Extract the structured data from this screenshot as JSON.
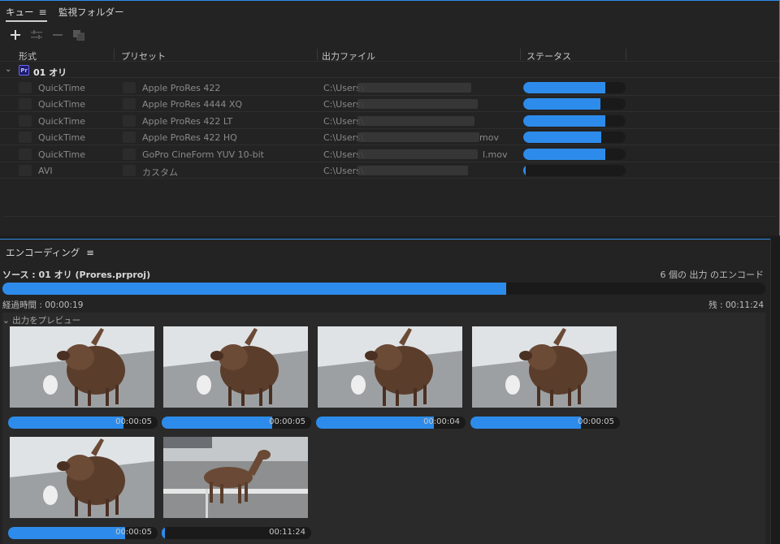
{
  "queue": {
    "tabs": [
      {
        "label": "キュー",
        "active": true
      },
      {
        "label": "監視フォルダー",
        "active": false
      }
    ],
    "menu_icon": "≡",
    "columns": {
      "format": "形式",
      "preset": "プリセット",
      "output": "出力ファイル",
      "status": "ステータス"
    },
    "group": {
      "badge": "Pr",
      "title": "01 オリ"
    },
    "rows": [
      {
        "format": "QuickTime",
        "preset": "Apple ProRes 422",
        "path": "C:\\Users\\",
        "suffix": "",
        "progress": 0.8
      },
      {
        "format": "QuickTime",
        "preset": "Apple ProRes 4444 XQ",
        "path": "C:\\Users\\",
        "suffix": "",
        "progress": 0.75
      },
      {
        "format": "QuickTime",
        "preset": "Apple ProRes 422 LT",
        "path": "C:\\Users\\",
        "suffix": "",
        "progress": 0.8
      },
      {
        "format": "QuickTime",
        "preset": "Apple ProRes 422 HQ",
        "path": "C:\\Users\\",
        "suffix": "mov",
        "progress": 0.76
      },
      {
        "format": "QuickTime",
        "preset": "GoPro CineForm YUV 10-bit",
        "path": "C:\\Users\\",
        "suffix": "l.mov",
        "progress": 0.8
      },
      {
        "format": "AVI",
        "preset": "カスタム",
        "path": "C:\\Users\\",
        "suffix": "",
        "progress": 0.02
      }
    ]
  },
  "encoding": {
    "title": "エンコーディング",
    "source": "ソース : 01 オリ (Prores.prproj)",
    "output_count": "6 個の 出力 のエンコード",
    "progress": 0.66,
    "elapsed": "経過時間 : 00:00:19",
    "remaining": "残 : 00:11:24",
    "preview_label": "出力をプレビュー",
    "thumbs": [
      {
        "time": "00:00:05",
        "progress": 0.77,
        "scene": "a"
      },
      {
        "time": "00:00:05",
        "progress": 0.74,
        "scene": "a"
      },
      {
        "time": "00:00:04",
        "progress": 0.79,
        "scene": "a"
      },
      {
        "time": "00:00:05",
        "progress": 0.74,
        "scene": "a"
      },
      {
        "time": "00:00:05",
        "progress": 0.78,
        "scene": "a"
      },
      {
        "time": "00:11:24",
        "progress": 0.02,
        "scene": "b"
      }
    ]
  },
  "colors": {
    "accent": "#2d8ceb",
    "panel": "#232323",
    "track": "#1a1a1a"
  }
}
